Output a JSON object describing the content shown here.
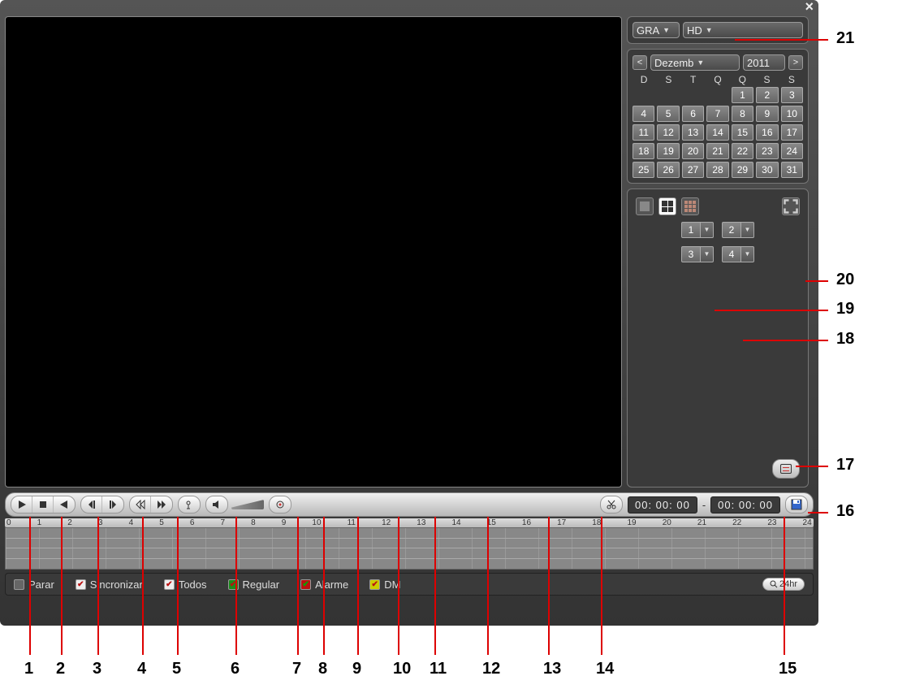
{
  "selects": {
    "type": "GRA",
    "storage": "HD",
    "month": "Dezemb",
    "year": "2011"
  },
  "calendar": {
    "dow": [
      "D",
      "S",
      "T",
      "Q",
      "Q",
      "S",
      "S"
    ],
    "firstDayOffset": 4,
    "daysInMonth": 31,
    "prev": "<",
    "next": ">"
  },
  "channels": [
    "1",
    "2",
    "3",
    "4"
  ],
  "controls": {
    "time_start": "00: 00: 00",
    "time_sep": "-",
    "time_end": "00: 00: 00"
  },
  "timeline": {
    "ticks": [
      "0",
      "1",
      "2",
      "3",
      "4",
      "5",
      "6",
      "7",
      "8",
      "9",
      "10",
      "11",
      "12",
      "13",
      "14",
      "15",
      "16",
      "17",
      "18",
      "19",
      "20",
      "21",
      "22",
      "23",
      "24"
    ]
  },
  "legend": {
    "stop": "Parar",
    "sync": "Sincronizar",
    "all": "Todos",
    "regular": "Regular",
    "alarm": "Alarme",
    "dm": "DM",
    "hr24": "24hr"
  },
  "callouts": {
    "1": "1",
    "2": "2",
    "3": "3",
    "4": "4",
    "5": "5",
    "6": "6",
    "7": "7",
    "8": "8",
    "9": "9",
    "10": "10",
    "11": "11",
    "12": "12",
    "13": "13",
    "14": "14",
    "15": "15",
    "16": "16",
    "17": "17",
    "18": "18",
    "19": "19",
    "20": "20",
    "21": "21"
  }
}
